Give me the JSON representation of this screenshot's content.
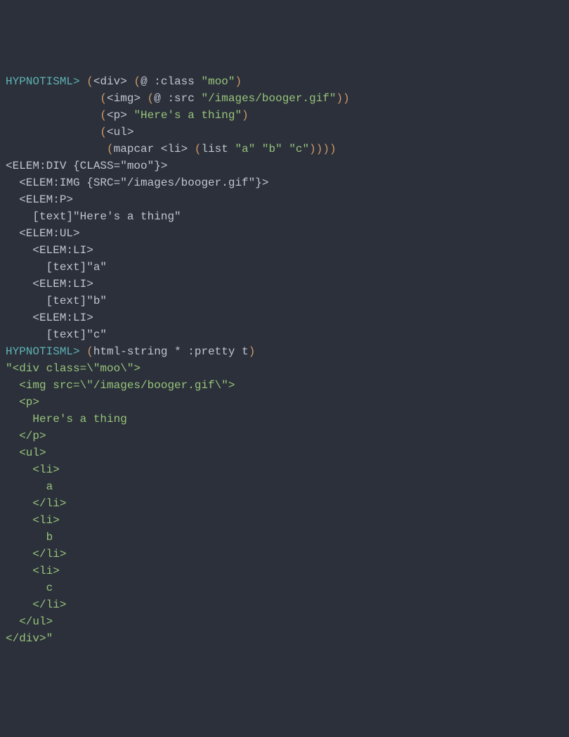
{
  "lines": [
    {
      "segments": [
        {
          "text": "HYPNOTISML>",
          "cls": "prompt"
        },
        {
          "text": " ",
          "cls": "output"
        },
        {
          "text": "(",
          "cls": "paren"
        },
        {
          "text": "<div> ",
          "cls": "output"
        },
        {
          "text": "(",
          "cls": "paren"
        },
        {
          "text": "@ :class ",
          "cls": "output"
        },
        {
          "text": "\"moo\"",
          "cls": "string"
        },
        {
          "text": ")",
          "cls": "paren"
        }
      ]
    },
    {
      "segments": [
        {
          "text": "              ",
          "cls": "output"
        },
        {
          "text": "(",
          "cls": "paren"
        },
        {
          "text": "<img> ",
          "cls": "output"
        },
        {
          "text": "(",
          "cls": "paren"
        },
        {
          "text": "@ :src ",
          "cls": "output"
        },
        {
          "text": "\"/images/booger.gif\"",
          "cls": "string"
        },
        {
          "text": "))",
          "cls": "paren"
        }
      ]
    },
    {
      "segments": [
        {
          "text": "              ",
          "cls": "output"
        },
        {
          "text": "(",
          "cls": "paren"
        },
        {
          "text": "<p> ",
          "cls": "output"
        },
        {
          "text": "\"Here's a thing\"",
          "cls": "string"
        },
        {
          "text": ")",
          "cls": "paren"
        }
      ]
    },
    {
      "segments": [
        {
          "text": "              ",
          "cls": "output"
        },
        {
          "text": "(",
          "cls": "paren"
        },
        {
          "text": "<ul>",
          "cls": "output"
        }
      ]
    },
    {
      "segments": [
        {
          "text": "               ",
          "cls": "output"
        },
        {
          "text": "(",
          "cls": "paren"
        },
        {
          "text": "mapcar <li> ",
          "cls": "output"
        },
        {
          "text": "(",
          "cls": "paren"
        },
        {
          "text": "list ",
          "cls": "output"
        },
        {
          "text": "\"a\"",
          "cls": "string"
        },
        {
          "text": " ",
          "cls": "output"
        },
        {
          "text": "\"b\"",
          "cls": "string"
        },
        {
          "text": " ",
          "cls": "output"
        },
        {
          "text": "\"c\"",
          "cls": "string"
        },
        {
          "text": "))))",
          "cls": "paren"
        }
      ]
    },
    {
      "segments": [
        {
          "text": "<ELEM:DIV {CLASS=\"moo\"}>",
          "cls": "output"
        }
      ]
    },
    {
      "segments": [
        {
          "text": "  <ELEM:IMG {SRC=\"/images/booger.gif\"}>",
          "cls": "output"
        }
      ]
    },
    {
      "segments": [
        {
          "text": "  <ELEM:P>",
          "cls": "output"
        }
      ]
    },
    {
      "segments": [
        {
          "text": "    [text]\"Here's a thing\"",
          "cls": "output"
        }
      ]
    },
    {
      "segments": [
        {
          "text": "  <ELEM:UL>",
          "cls": "output"
        }
      ]
    },
    {
      "segments": [
        {
          "text": "    <ELEM:LI>",
          "cls": "output"
        }
      ]
    },
    {
      "segments": [
        {
          "text": "      [text]\"a\"",
          "cls": "output"
        }
      ]
    },
    {
      "segments": [
        {
          "text": "    <ELEM:LI>",
          "cls": "output"
        }
      ]
    },
    {
      "segments": [
        {
          "text": "      [text]\"b\"",
          "cls": "output"
        }
      ]
    },
    {
      "segments": [
        {
          "text": "    <ELEM:LI>",
          "cls": "output"
        }
      ]
    },
    {
      "segments": [
        {
          "text": "      [text]\"c\"",
          "cls": "output"
        }
      ]
    },
    {
      "segments": [
        {
          "text": "HYPNOTISML>",
          "cls": "prompt"
        },
        {
          "text": " ",
          "cls": "output"
        },
        {
          "text": "(",
          "cls": "paren"
        },
        {
          "text": "html-string * :pretty t",
          "cls": "output"
        },
        {
          "text": ")",
          "cls": "paren"
        }
      ]
    },
    {
      "segments": [
        {
          "text": "\"<div class=\\\"moo\\\">",
          "cls": "string"
        }
      ]
    },
    {
      "segments": [
        {
          "text": "  <img src=\\\"/images/booger.gif\\\">",
          "cls": "string"
        }
      ]
    },
    {
      "segments": [
        {
          "text": "  <p>",
          "cls": "string"
        }
      ]
    },
    {
      "segments": [
        {
          "text": "    Here's a thing",
          "cls": "string"
        }
      ]
    },
    {
      "segments": [
        {
          "text": "  </p>",
          "cls": "string"
        }
      ]
    },
    {
      "segments": [
        {
          "text": "  <ul>",
          "cls": "string"
        }
      ]
    },
    {
      "segments": [
        {
          "text": "    <li>",
          "cls": "string"
        }
      ]
    },
    {
      "segments": [
        {
          "text": "      a",
          "cls": "string"
        }
      ]
    },
    {
      "segments": [
        {
          "text": "    </li>",
          "cls": "string"
        }
      ]
    },
    {
      "segments": [
        {
          "text": "    <li>",
          "cls": "string"
        }
      ]
    },
    {
      "segments": [
        {
          "text": "      b",
          "cls": "string"
        }
      ]
    },
    {
      "segments": [
        {
          "text": "    </li>",
          "cls": "string"
        }
      ]
    },
    {
      "segments": [
        {
          "text": "    <li>",
          "cls": "string"
        }
      ]
    },
    {
      "segments": [
        {
          "text": "      c",
          "cls": "string"
        }
      ]
    },
    {
      "segments": [
        {
          "text": "    </li>",
          "cls": "string"
        }
      ]
    },
    {
      "segments": [
        {
          "text": "  </ul>",
          "cls": "string"
        }
      ]
    },
    {
      "segments": [
        {
          "text": "</div>\"",
          "cls": "string"
        }
      ]
    }
  ]
}
